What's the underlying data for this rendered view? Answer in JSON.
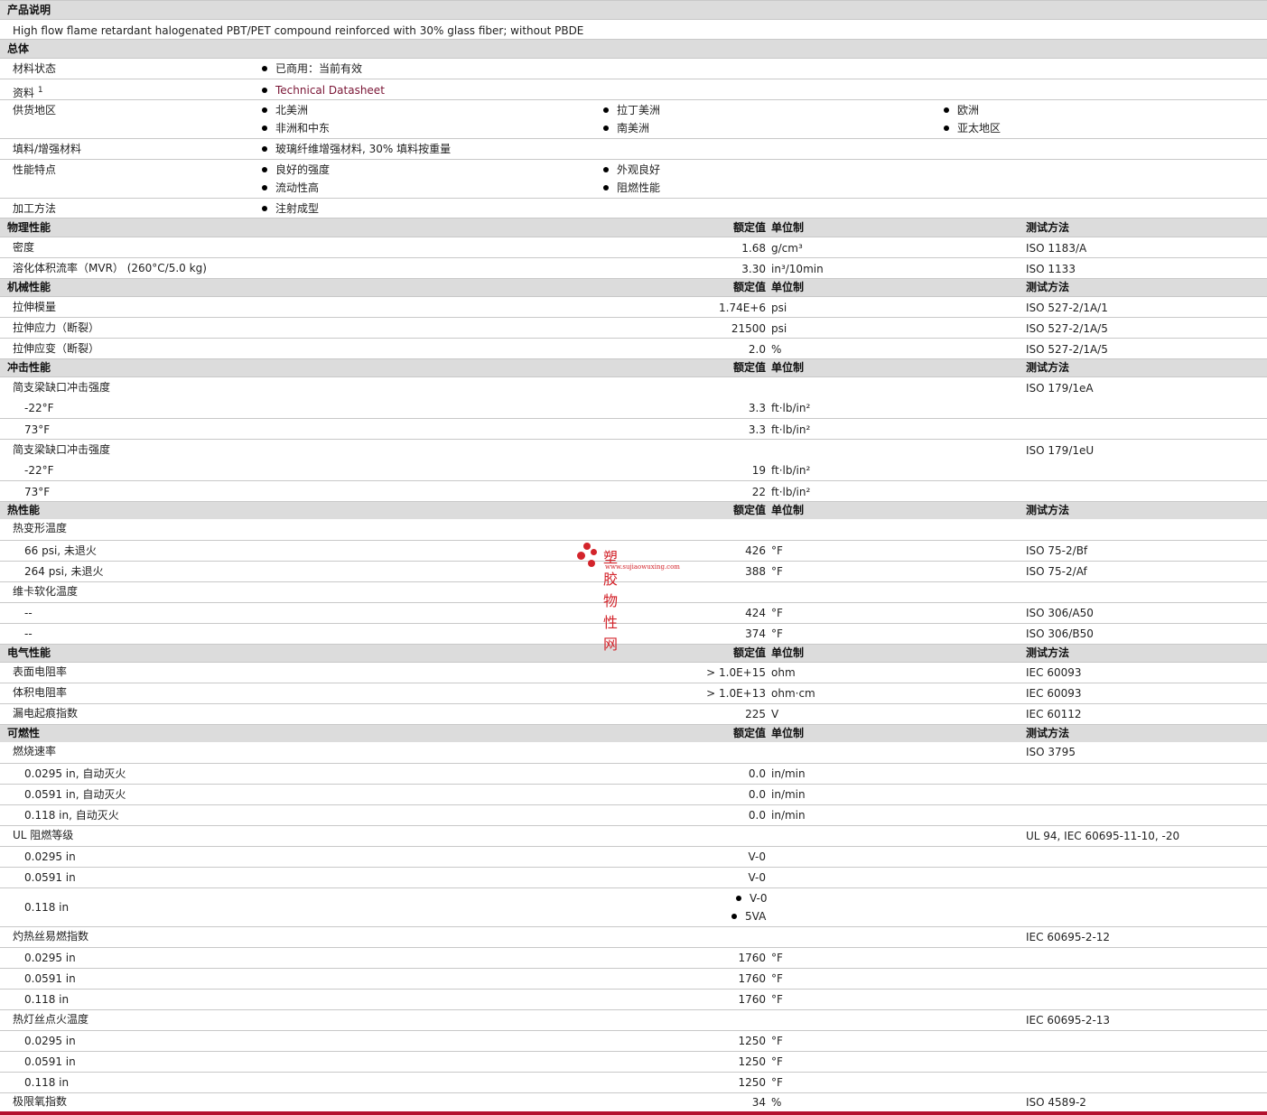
{
  "description": {
    "header": "产品说明",
    "text": "High flow flame retardant halogenated PBT/PET compound reinforced with 30% glass fiber; without PBDE"
  },
  "general": {
    "header": "总体",
    "status_label": "材料状态",
    "status_value": "已商用：当前有效",
    "resources_label": "资料",
    "resources_sup": "1",
    "resources_value": "Technical Datasheet",
    "availability_label": "供货地区",
    "availability": [
      "北美洲",
      "拉丁美洲",
      "欧洲",
      "非洲和中东",
      "南美洲",
      "亚太地区"
    ],
    "filler_label": "填料/增强材料",
    "filler_value": "玻璃纤维增强材料, 30% 填料按重量",
    "features_label": "性能特点",
    "features": [
      "良好的强度",
      "外观良好",
      "流动性高",
      "阻燃性能"
    ],
    "processing_label": "加工方法",
    "processing_value": "注射成型"
  },
  "col_headers": {
    "value": "额定值",
    "unit": "单位制",
    "method": "测试方法"
  },
  "physical": {
    "header": "物理性能",
    "rows": [
      {
        "name": "密度",
        "value": "1.68",
        "unit": "g/cm³",
        "method": "ISO 1183/A"
      },
      {
        "name": "溶化体积流率（MVR） (260°C/5.0 kg)",
        "value": "3.30",
        "unit": "in³/10min",
        "method": "ISO 1133"
      }
    ]
  },
  "mechanical": {
    "header": "机械性能",
    "rows": [
      {
        "name": "拉伸模量",
        "value": "1.74E+6",
        "unit": "psi",
        "method": "ISO 527-2/1A/1"
      },
      {
        "name": "拉伸应力（断裂）",
        "value": "21500",
        "unit": "psi",
        "method": "ISO 527-2/1A/5"
      },
      {
        "name": "拉伸应变（断裂）",
        "value": "2.0",
        "unit": "%",
        "method": "ISO 527-2/1A/5"
      }
    ]
  },
  "impact": {
    "header": "冲击性能",
    "charpy_notched": {
      "name": "简支梁缺口冲击强度",
      "method": "ISO 179/1eA"
    },
    "charpy_notched_rows": [
      {
        "name": "-22°F",
        "value": "3.3",
        "unit": "ft·lb/in²"
      },
      {
        "name": "73°F",
        "value": "3.3",
        "unit": "ft·lb/in²"
      }
    ],
    "charpy_unnotched": {
      "name": "简支梁缺口冲击强度",
      "method": "ISO 179/1eU"
    },
    "charpy_unnotched_rows": [
      {
        "name": "-22°F",
        "value": "19",
        "unit": "ft·lb/in²"
      },
      {
        "name": "73°F",
        "value": "22",
        "unit": "ft·lb/in²"
      }
    ]
  },
  "thermal": {
    "header": "热性能",
    "hdt_name": "热变形温度",
    "hdt_rows": [
      {
        "name": "66 psi, 未退火",
        "value": "426",
        "unit": "°F",
        "method": "ISO 75-2/Bf"
      },
      {
        "name": "264 psi, 未退火",
        "value": "388",
        "unit": "°F",
        "method": "ISO 75-2/Af"
      }
    ],
    "vicat_name": "维卡软化温度",
    "vicat_rows": [
      {
        "name": "--",
        "value": "424",
        "unit": "°F",
        "method": "ISO 306/A50"
      },
      {
        "name": "--",
        "value": "374",
        "unit": "°F",
        "method": "ISO 306/B50"
      }
    ]
  },
  "electrical": {
    "header": "电气性能",
    "rows": [
      {
        "name": "表面电阻率",
        "value": "> 1.0E+15",
        "unit": "ohm",
        "method": "IEC 60093"
      },
      {
        "name": "体积电阻率",
        "value": "> 1.0E+13",
        "unit": "ohm·cm",
        "method": "IEC 60093"
      },
      {
        "name": "漏电起痕指数",
        "value": "225",
        "unit": "V",
        "method": "IEC 60112"
      }
    ]
  },
  "flammability": {
    "header": "可燃性",
    "burn_name": "燃烧速率",
    "burn_method": "ISO 3795",
    "burn_rows": [
      {
        "name": "0.0295 in, 自动灭火",
        "value": "0.0",
        "unit": "in/min"
      },
      {
        "name": "0.0591 in, 自动灭火",
        "value": "0.0",
        "unit": "in/min"
      },
      {
        "name": "0.118 in, 自动灭火",
        "value": "0.0",
        "unit": "in/min"
      }
    ],
    "ul_name": "UL 阻燃等级",
    "ul_method": "UL 94, IEC 60695-11-10, -20",
    "ul_rows": [
      {
        "name": "0.0295 in",
        "value": "V-0"
      },
      {
        "name": "0.0591 in",
        "value": "V-0"
      }
    ],
    "ul_last_name": "0.118 in",
    "ul_last_values": [
      "V-0",
      "5VA"
    ],
    "gwfi_name": "灼热丝易燃指数",
    "gwfi_method": "IEC 60695-2-12",
    "gwfi_rows": [
      {
        "name": "0.0295 in",
        "value": "1760",
        "unit": "°F"
      },
      {
        "name": "0.0591 in",
        "value": "1760",
        "unit": "°F"
      },
      {
        "name": "0.118 in",
        "value": "1760",
        "unit": "°F"
      }
    ],
    "gwit_name": "热灯丝点火温度",
    "gwit_method": "IEC 60695-2-13",
    "gwit_rows": [
      {
        "name": "0.0295 in",
        "value": "1250",
        "unit": "°F"
      },
      {
        "name": "0.0591 in",
        "value": "1250",
        "unit": "°F"
      },
      {
        "name": "0.118 in",
        "value": "1250",
        "unit": "°F"
      }
    ],
    "loi": {
      "name": "极限氧指数",
      "value": "34",
      "unit": "%",
      "method": "ISO 4589-2"
    }
  },
  "watermark": {
    "title": "塑胶物性网",
    "url": "www.sujiaowuxing.com"
  }
}
